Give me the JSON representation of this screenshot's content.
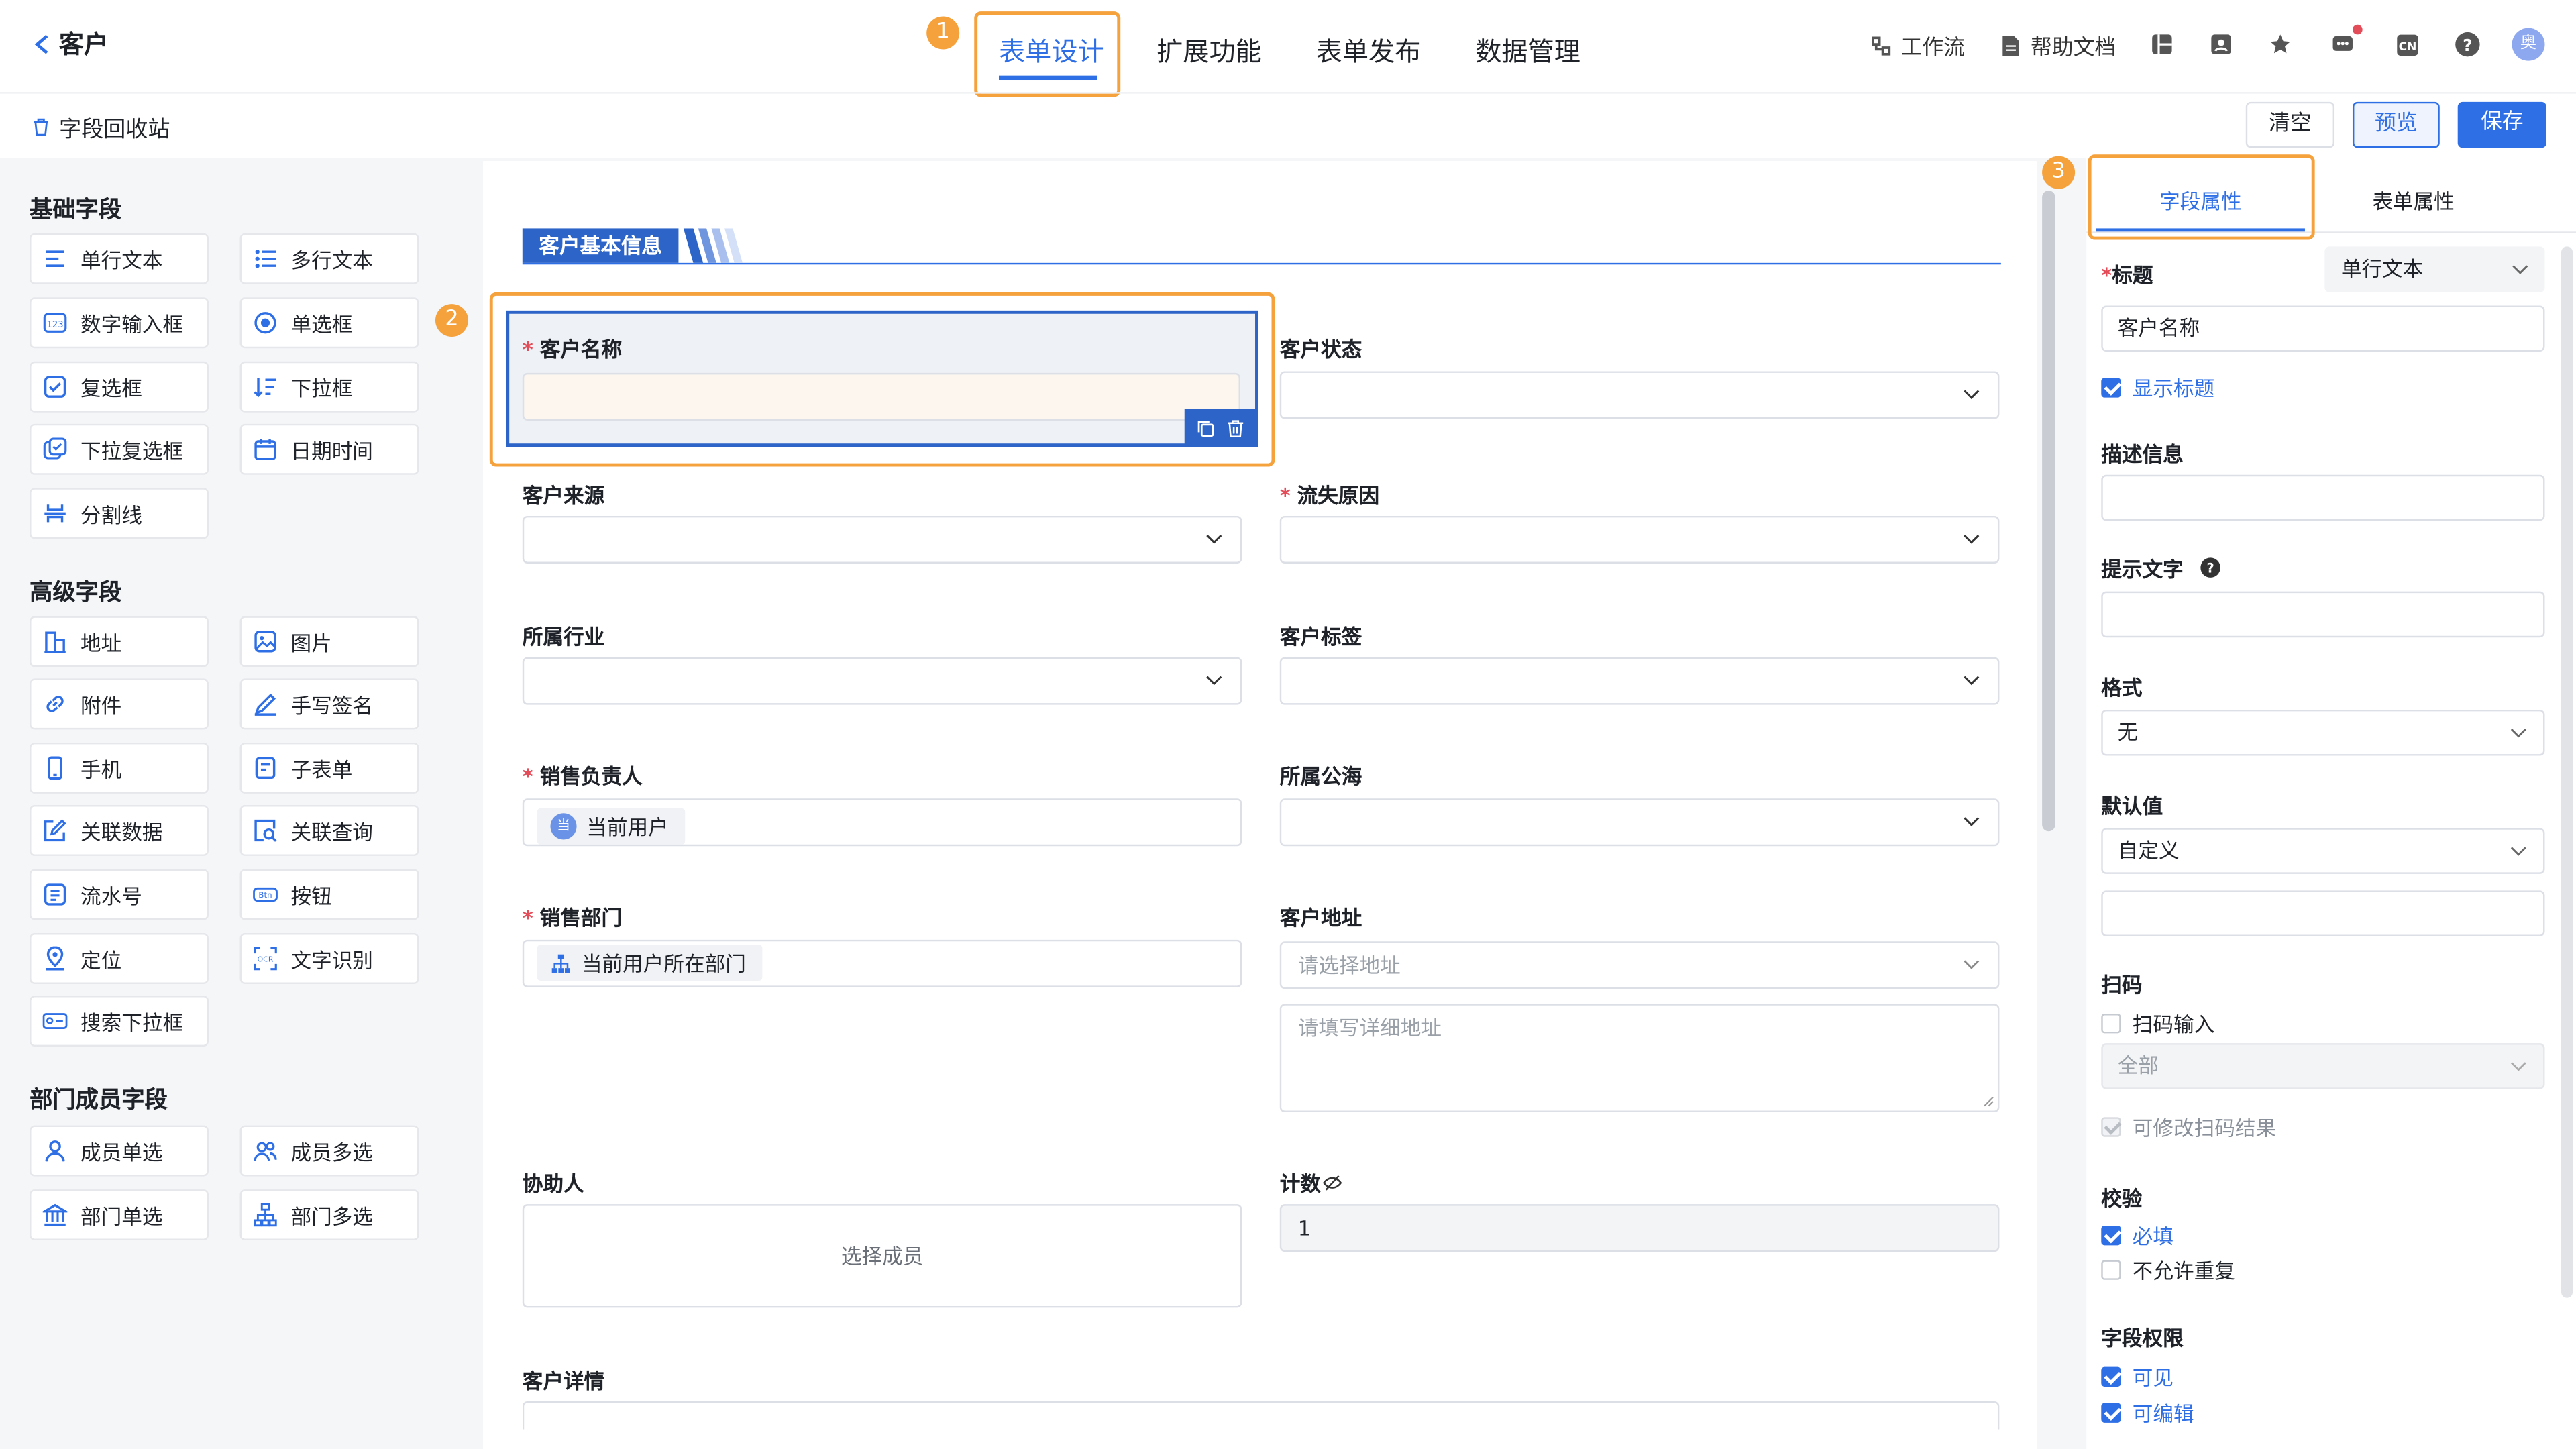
{
  "header": {
    "back_label": "客户",
    "tabs": [
      {
        "label": "表单设计",
        "active": true
      },
      {
        "label": "扩展功能"
      },
      {
        "label": "表单发布"
      },
      {
        "label": "数据管理"
      }
    ],
    "workflow_label": "工作流",
    "help_label": "帮助文档",
    "avatar_text": "奥"
  },
  "callouts": {
    "one": "1",
    "two": "2",
    "three": "3"
  },
  "subbar": {
    "recycle_label": "字段回收站",
    "clear_label": "清空",
    "preview_label": "预览",
    "save_label": "保存"
  },
  "sidebar": {
    "basic_title": "基础字段",
    "basic": [
      "单行文本",
      "多行文本",
      "数字输入框",
      "单选框",
      "复选框",
      "下拉框",
      "下拉复选框",
      "日期时间",
      "分割线"
    ],
    "advanced_title": "高级字段",
    "advanced": [
      "地址",
      "图片",
      "附件",
      "手写签名",
      "手机",
      "子表单",
      "关联数据",
      "关联查询",
      "流水号",
      "按钮",
      "定位",
      "文字识别",
      "搜索下拉框"
    ],
    "dept_title": "部门成员字段",
    "dept": [
      "成员单选",
      "成员多选",
      "部门单选",
      "部门多选"
    ]
  },
  "form": {
    "section_title": "客户基本信息",
    "fields": {
      "name": {
        "label": "客户名称",
        "required": "*"
      },
      "status": {
        "label": "客户状态"
      },
      "source": {
        "label": "客户来源"
      },
      "loss": {
        "label": "流失原因",
        "required": "*"
      },
      "industry": {
        "label": "所属行业"
      },
      "tags": {
        "label": "客户标签"
      },
      "sales": {
        "label": "销售负责人",
        "required": "*",
        "value": "当前用户"
      },
      "pool": {
        "label": "所属公海"
      },
      "dept": {
        "label": "销售部门",
        "required": "*",
        "value": "当前用户所在部门"
      },
      "address": {
        "label": "客户地址",
        "placeholder": "请选择地址",
        "detail_placeholder": "请填写详细地址"
      },
      "assist": {
        "label": "协助人",
        "placeholder": "选择成员"
      },
      "count": {
        "label": "计数",
        "value": "1"
      },
      "detail": {
        "label": "客户详情"
      }
    }
  },
  "props": {
    "tab_field": "字段属性",
    "tab_form": "表单属性",
    "title_label": "标题",
    "required_star": "*",
    "type_value": "单行文本",
    "title_value": "客户名称",
    "show_title": "显示标题",
    "desc_label": "描述信息",
    "hint_label": "提示文字",
    "format_label": "格式",
    "format_value": "无",
    "default_label": "默认值",
    "default_value": "自定义",
    "scan_label": "扫码",
    "scan_input": "扫码输入",
    "scan_scope": "全部",
    "scan_editable": "可修改扫码结果",
    "validate_label": "校验",
    "required": "必填",
    "no_dup": "不允许重复",
    "perm_label": "字段权限",
    "visible": "可见",
    "editable": "可编辑"
  },
  "colors": {
    "accent": "#2f6fe6",
    "callout": "#f5a13c",
    "section": "#2d64c8",
    "required": "#e34d59"
  }
}
